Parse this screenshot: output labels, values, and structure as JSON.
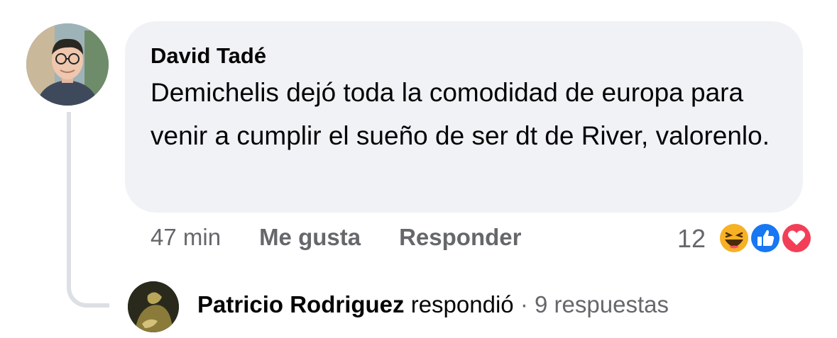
{
  "comment": {
    "author": "David Tadé",
    "text": "Demichelis dejó toda la comodidad de europa para venir a cumplir el sueño de ser dt de River, valorenlo.",
    "time": "47 min",
    "like_label": "Me gusta",
    "reply_label": "Responder",
    "reaction_count": "12",
    "reaction_icons": [
      "haha-icon",
      "like-icon",
      "love-icon"
    ]
  },
  "reply_summary": {
    "name": "Patricio Rodriguez",
    "verb": "respondió",
    "separator": "·",
    "count_text": "9 respuestas"
  },
  "colors": {
    "bubble": "#f0f2f5",
    "secondary_text": "#65676b",
    "primary_text": "#050505",
    "like_blue": "#1877f2",
    "love_red": "#f33e58",
    "haha_yellow": "#f7b125"
  }
}
